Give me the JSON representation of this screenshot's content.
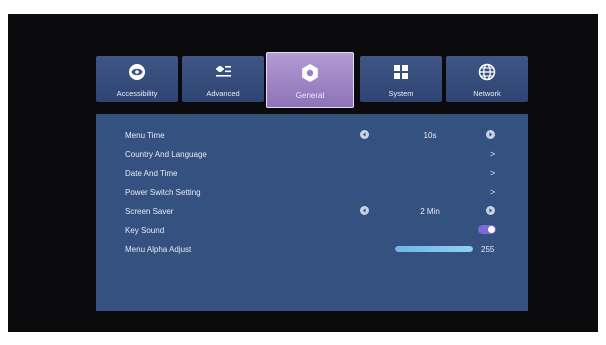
{
  "tabs": [
    {
      "label": "Accessibility",
      "icon": "eye-icon",
      "active": false
    },
    {
      "label": "Advanced",
      "icon": "sliders-icon",
      "active": false
    },
    {
      "label": "General",
      "icon": "gear-icon",
      "active": true
    },
    {
      "label": "System",
      "icon": "grid-icon",
      "active": false
    },
    {
      "label": "Network",
      "icon": "globe-icon",
      "active": false
    }
  ],
  "settings": {
    "menu_time": {
      "label": "Menu Time",
      "value": "10s"
    },
    "country_language": {
      "label": "Country And Language"
    },
    "date_time": {
      "label": "Date And Time"
    },
    "power_switch": {
      "label": "Power Switch Setting"
    },
    "screen_saver": {
      "label": "Screen Saver",
      "value": "2 Min"
    },
    "key_sound": {
      "label": "Key Sound",
      "enabled": true
    },
    "menu_alpha": {
      "label": "Menu Alpha Adjust",
      "value": "255",
      "max": 255
    }
  },
  "colors": {
    "panel": "#35517f",
    "tab": "#3f5684",
    "active_tab": "#a58bc9",
    "toggle": "#7c6ad8",
    "slider": "#8fd0f4"
  }
}
